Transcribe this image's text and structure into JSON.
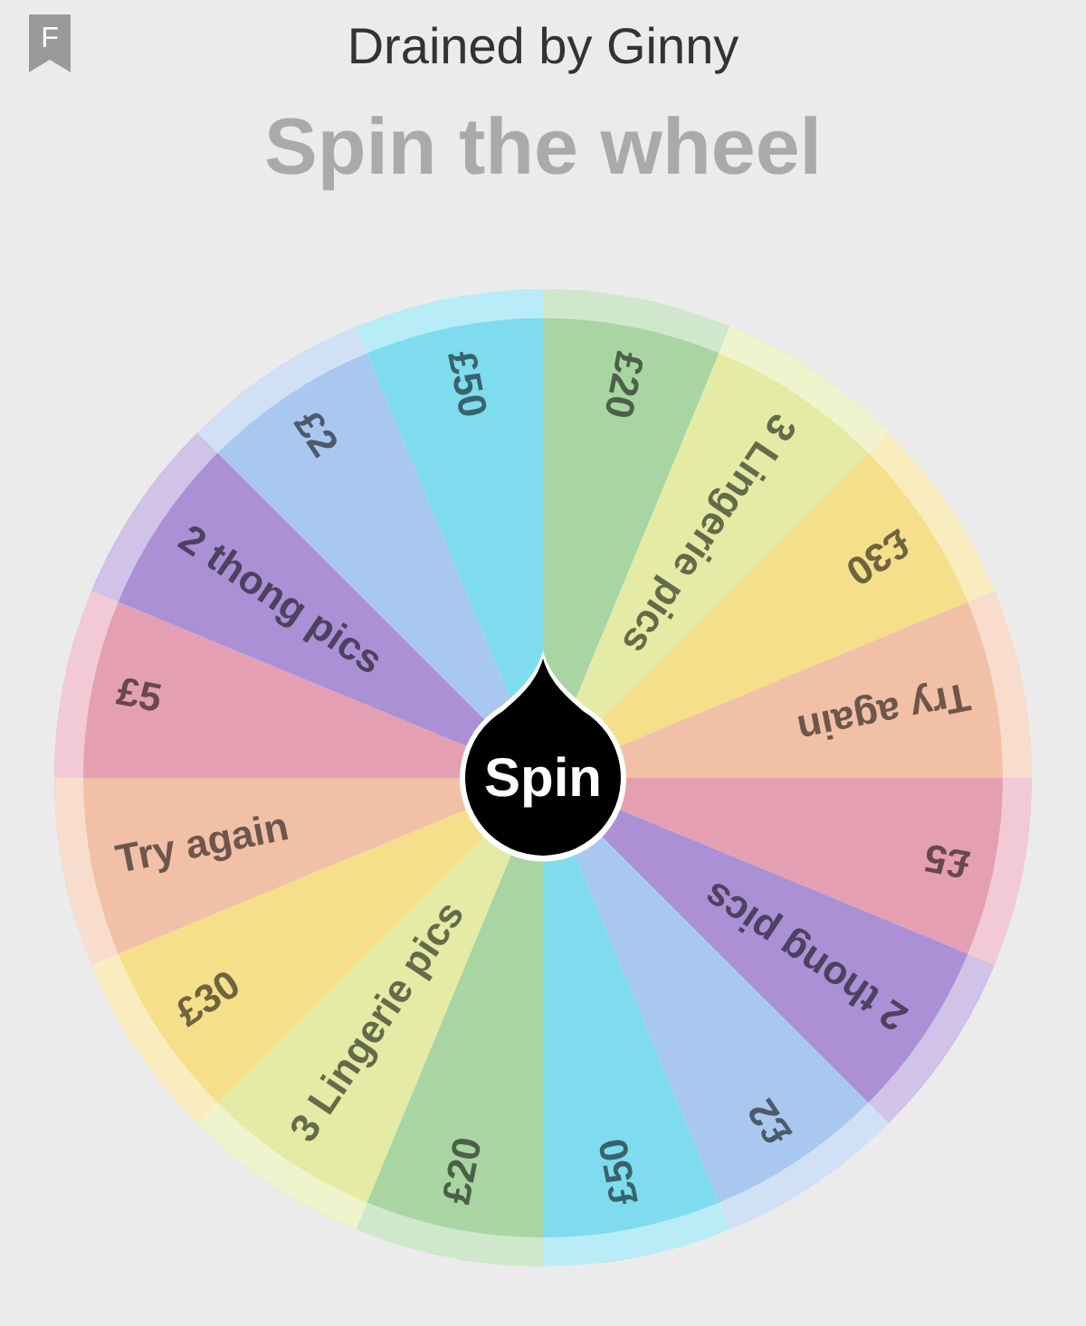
{
  "header": {
    "badge": "F",
    "title": "Drained by Ginny"
  },
  "heading": "Spin the wheel",
  "wheel": {
    "button": "Spin",
    "segments": [
      {
        "label": "£20",
        "color": "#a8d5a2"
      },
      {
        "label": "3 Lingerie pics",
        "color": "#e3eba4"
      },
      {
        "label": "£30",
        "color": "#f5df8a"
      },
      {
        "label": "Try again",
        "color": "#f2c0a6"
      },
      {
        "label": "£5",
        "color": "#e59fb2"
      },
      {
        "label": "2 thong pics",
        "color": "#ab90d6"
      },
      {
        "label": "£2",
        "color": "#a9c8ef"
      },
      {
        "label": "£50",
        "color": "#7fdcef"
      },
      {
        "label": "£20",
        "color": "#a8d5a2"
      },
      {
        "label": "3 Lingerie pics",
        "color": "#e3eba4"
      },
      {
        "label": "£30",
        "color": "#f5df8a"
      },
      {
        "label": "Try again",
        "color": "#f2c0a6"
      },
      {
        "label": "£5",
        "color": "#e59fb2"
      },
      {
        "label": "2 thong pics",
        "color": "#ab90d6"
      },
      {
        "label": "£2",
        "color": "#a9c8ef"
      },
      {
        "label": "£50",
        "color": "#7fdcef"
      }
    ]
  }
}
